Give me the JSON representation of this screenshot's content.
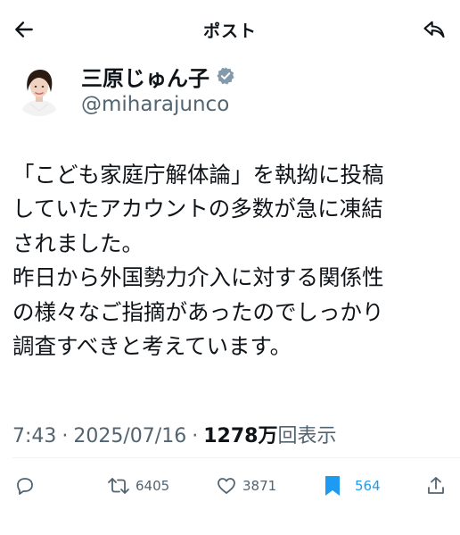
{
  "header": {
    "title": "ポスト"
  },
  "author": {
    "display_name": "三原じゅん子",
    "handle": "@miharajunco"
  },
  "post": {
    "lines": [
      "「こども家庭庁解体論」を執拗に投稿",
      "していたアカウントの多数が急に凍結",
      "されました。",
      "昨日から外国勢力介入に対する関係性",
      "の様々なご指摘があったのでしっかり",
      "調査すべきと考えています。"
    ]
  },
  "meta": {
    "time": "7:43",
    "separator": "·",
    "date": "2025/07/16",
    "views_number": "1278",
    "views_unit": "万",
    "views_label": "回表示"
  },
  "actions": {
    "retweets": "6405",
    "likes": "3871",
    "bookmarks": "564"
  },
  "colors": {
    "accent": "#1d9bf0",
    "text": "#0f1419",
    "secondary": "#536471",
    "verified_badge": "#829aab"
  },
  "icons": [
    "back-arrow-icon",
    "reply-icon",
    "verified-badge-icon",
    "comment-icon",
    "retweet-icon",
    "heart-icon",
    "bookmark-icon",
    "share-icon"
  ]
}
